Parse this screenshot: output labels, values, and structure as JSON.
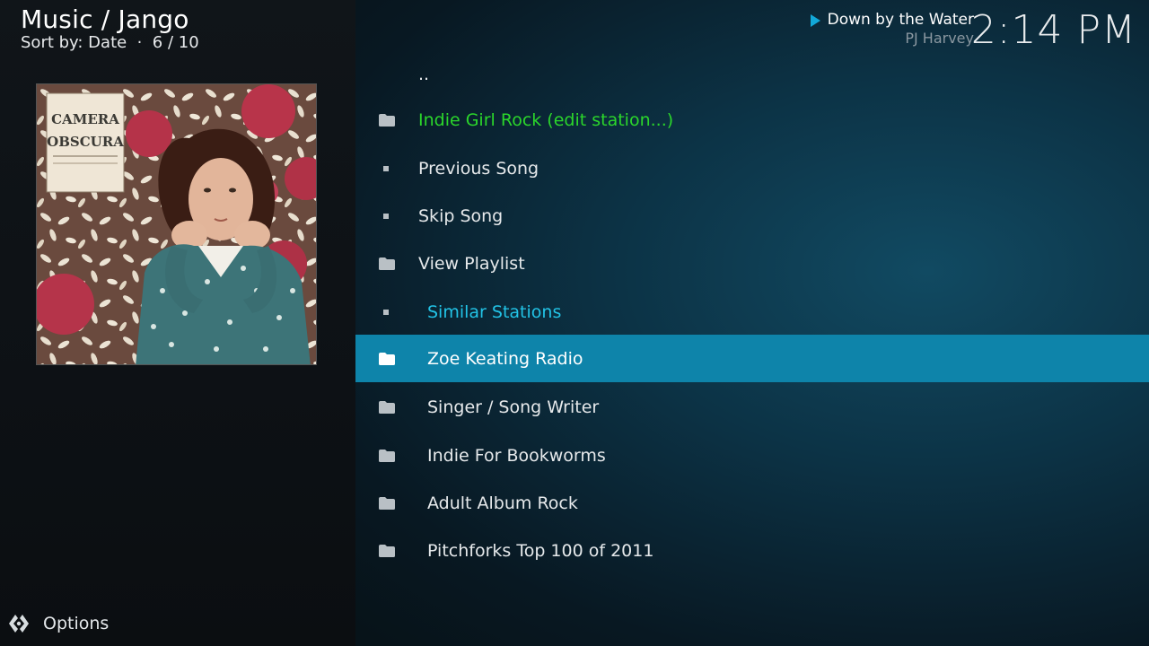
{
  "header": {
    "title": "Music / Jango",
    "sort_info": "Sort by: Date  ·  6 / 10"
  },
  "now_playing": {
    "title": "Down by the Water",
    "artist": "PJ Harvey",
    "icon": "play-icon"
  },
  "clock": "2:14 PM",
  "album_art": {
    "lines": [
      "CAMERA",
      "OBSCURA"
    ]
  },
  "list": {
    "items": [
      {
        "label": "..",
        "icon": "none",
        "color": "#e6e9eb"
      },
      {
        "label": "Indie Girl Rock (edit station...)",
        "icon": "folder-icon",
        "color": "#2bd62b"
      },
      {
        "label": "Previous Song",
        "icon": "square-bullet-icon",
        "color": "#e6e9eb"
      },
      {
        "label": "Skip Song",
        "icon": "square-bullet-icon",
        "color": "#e6e9eb"
      },
      {
        "label": "View Playlist",
        "icon": "folder-icon",
        "color": "#e6e9eb"
      },
      {
        "label": "Similar Stations",
        "icon": "square-bullet-icon",
        "color": "#22c3e6"
      },
      {
        "label": "Zoe Keating Radio",
        "icon": "folder-icon",
        "color": "#ffffff",
        "selected": true
      },
      {
        "label": "Singer / Song Writer",
        "icon": "folder-icon",
        "color": "#e6e9eb"
      },
      {
        "label": "Indie For Bookworms",
        "icon": "folder-icon",
        "color": "#e6e9eb"
      },
      {
        "label": "Adult Album Rock",
        "icon": "folder-icon",
        "color": "#e6e9eb"
      },
      {
        "label": "Pitchforks Top 100 of 2011",
        "icon": "folder-icon",
        "color": "#e6e9eb"
      }
    ]
  },
  "options": {
    "label": "Options",
    "icon": "options-icon"
  },
  "colors": {
    "selection": "#0e84aa",
    "accent_green": "#2bd62b",
    "accent_cyan": "#22c3e6",
    "play_icon": "#12a8d8"
  }
}
